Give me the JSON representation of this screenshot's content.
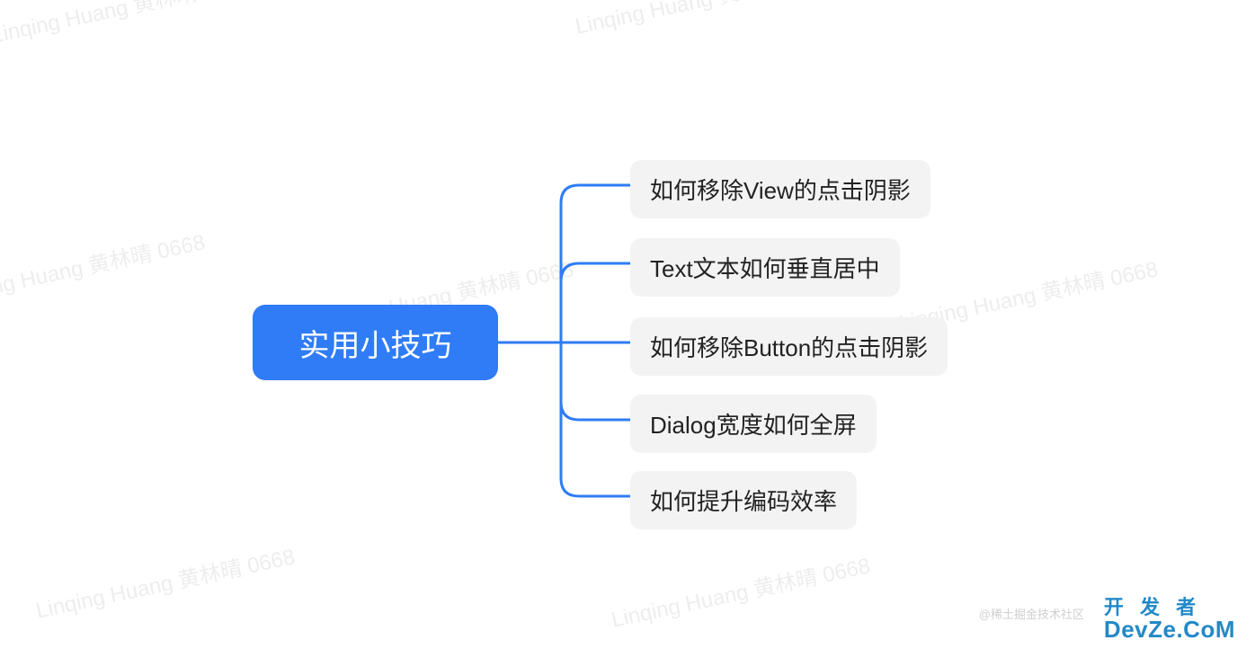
{
  "watermark_text": "Linqing Huang 黄林晴 0668",
  "root": {
    "label": "实用小技巧"
  },
  "children": [
    {
      "label": "如何移除View的点击阴影"
    },
    {
      "label": "Text文本如何垂直居中"
    },
    {
      "label": "如何移除Button的点击阴影"
    },
    {
      "label": "Dialog宽度如何全屏"
    },
    {
      "label": "如何提升编码效率"
    }
  ],
  "logo": {
    "line1": "开 发 者",
    "line2": "DevZe.CoM"
  },
  "footer_credit": "@稀土掘金技术社区",
  "colors": {
    "primary": "#2f7cf6",
    "child_bg": "#f3f3f3",
    "watermark": "#e0e0e0",
    "logo": "#2389c7"
  }
}
